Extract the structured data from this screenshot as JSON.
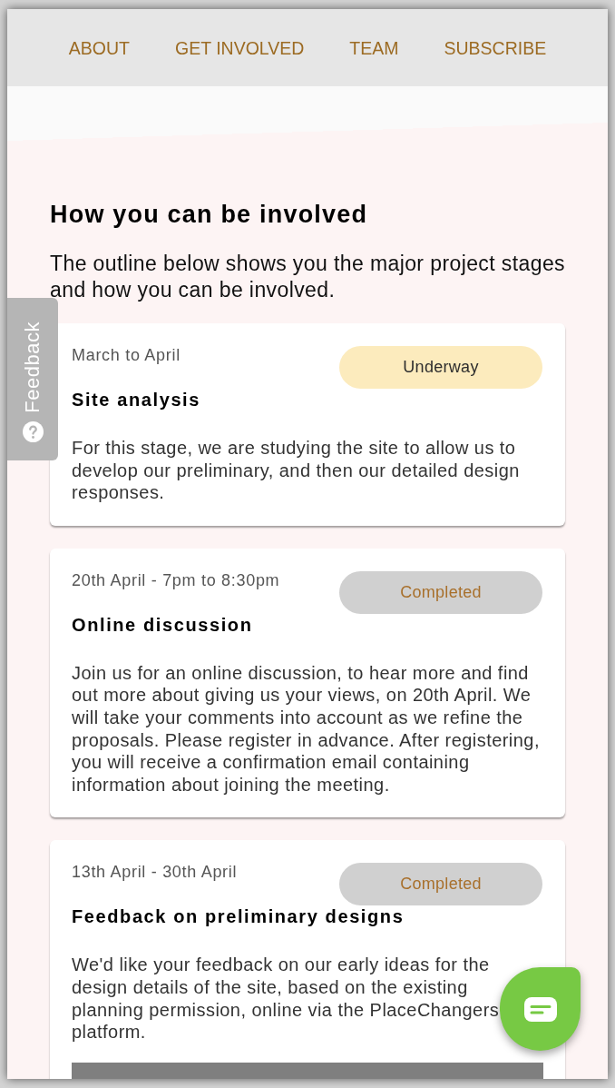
{
  "nav": {
    "links": [
      {
        "label": "ABOUT"
      },
      {
        "label": "GET INVOLVED"
      },
      {
        "label": "TEAM"
      },
      {
        "label": "SUBSCRIBE"
      }
    ]
  },
  "feedback_tab": {
    "label": "Feedback"
  },
  "section": {
    "heading": "How you can be involved",
    "lead": "The outline below shows you the major project stages and how you can be involved."
  },
  "stages": [
    {
      "date": "March to April",
      "status": {
        "kind": "underway",
        "label": "Underway"
      },
      "title": "Site analysis",
      "description": "For this stage, we are studying the site to allow us to develop our preliminary, and then our detailed design responses.",
      "image": false
    },
    {
      "date": "20th April - 7pm to 8:30pm",
      "status": {
        "kind": "completed",
        "label": "Completed"
      },
      "title": "Online discussion",
      "description": "Join us for an online discussion, to hear more and find out more about giving us your views, on 20th April. We will take your comments into account as we refine the proposals. Please register in advance. After registering, you will receive a confirmation email containing information about joining the meeting.",
      "image": false
    },
    {
      "date": "13th April - 30th April",
      "status": {
        "kind": "completed",
        "label": "Completed"
      },
      "title": "Feedback on preliminary designs",
      "description": "We'd like your feedback on our early ideas for the design details of the site, based on the existing planning permission, online via the PlaceChangers platform.",
      "image": true
    }
  ]
}
